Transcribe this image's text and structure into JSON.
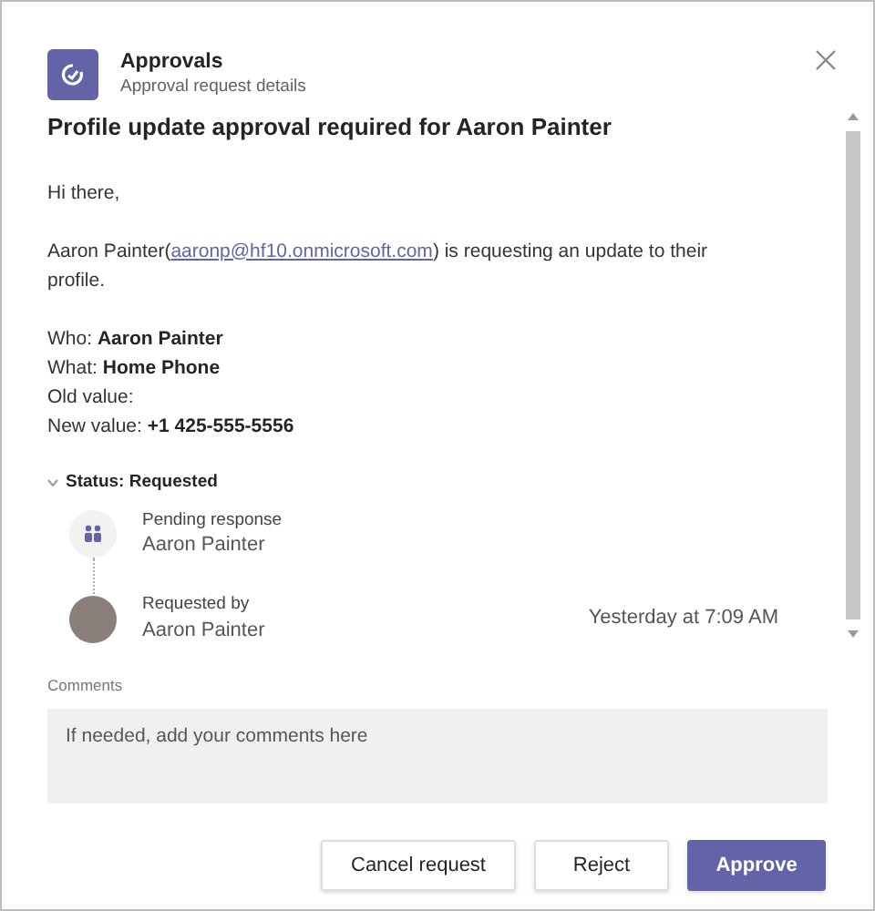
{
  "header": {
    "app_name": "Approvals",
    "subtitle": "Approval request details"
  },
  "title": "Profile update approval required for Aaron Painter",
  "greeting": "Hi there,",
  "message": {
    "before": "Aaron Painter(",
    "link": "aaronp@hf10.onmicrosoft.com",
    "after": ") is requesting an update to their profile."
  },
  "fields": [
    {
      "label": "Who:",
      "value": "Aaron Painter"
    },
    {
      "label": "What:",
      "value": "Home Phone"
    },
    {
      "label": "Old value:"
    },
    {
      "label": "New value:",
      "value": "+1 425-555-5556"
    }
  ],
  "status": {
    "label": "Status: Requested",
    "expanded": true
  },
  "timeline": [
    {
      "kind": "group",
      "label": "Pending response",
      "name": "Aaron Painter"
    },
    {
      "kind": "person",
      "label": "Requested by",
      "name": "Aaron Painter",
      "time": "Yesterday at 7:09 AM"
    }
  ],
  "comments": {
    "label": "Comments",
    "placeholder": "If needed, add your comments here"
  },
  "buttons": [
    {
      "label": "Cancel request",
      "kind": "default"
    },
    {
      "label": "Reject",
      "kind": "default"
    },
    {
      "label": "Approve",
      "kind": "primary"
    }
  ]
}
